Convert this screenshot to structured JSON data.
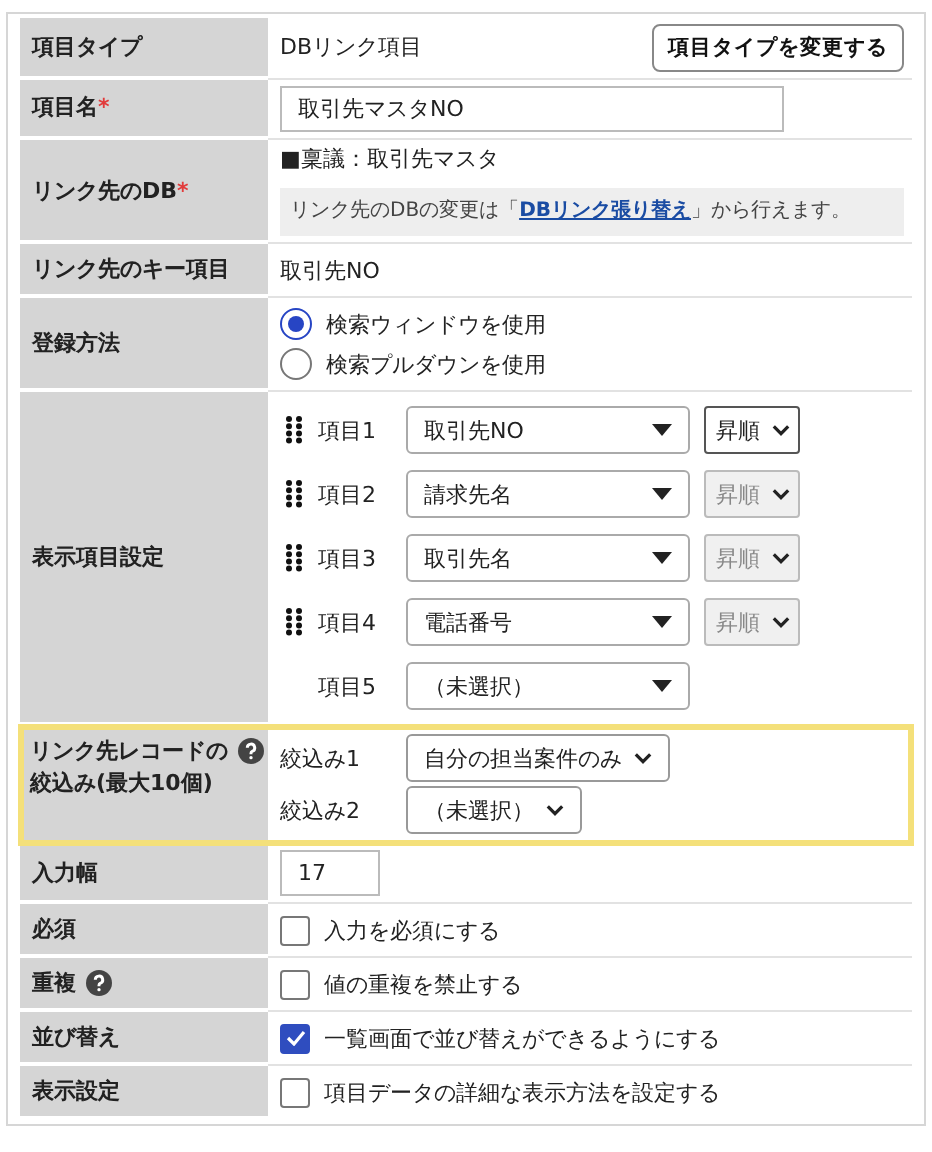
{
  "rows": [
    {
      "kind": "type",
      "label": "項目タイプ",
      "value": "DBリンク項目",
      "button": "項目タイプを変更する"
    },
    {
      "kind": "name",
      "label": "項目名",
      "required_mark": "*",
      "value": "取引先マスタNO"
    },
    {
      "kind": "db",
      "label": "リンク先のDB",
      "required_mark": "*",
      "value": "■稟議：取引先マスタ",
      "note_before": "リンク先のDBの変更は「",
      "link": "DBリンク張り替え",
      "note_after": "」から行えます。"
    },
    {
      "kind": "text",
      "label": "リンク先のキー項目",
      "value": "取引先NO"
    },
    {
      "kind": "radio",
      "label": "登録方法",
      "options": [
        {
          "label": "検索ウィンドウを使用",
          "selected": true
        },
        {
          "label": "検索プルダウンを使用",
          "selected": false
        }
      ]
    },
    {
      "kind": "display",
      "label": "表示項目設定",
      "items": [
        {
          "label": "項目1",
          "value": "取引先NO",
          "draggable": true,
          "order": "昇順",
          "order_disabled": false
        },
        {
          "label": "項目2",
          "value": "請求先名",
          "draggable": true,
          "order": "昇順",
          "order_disabled": true
        },
        {
          "label": "項目3",
          "value": "取引先名",
          "draggable": true,
          "order": "昇順",
          "order_disabled": true
        },
        {
          "label": "項目4",
          "value": "電話番号",
          "draggable": true,
          "order": "昇順",
          "order_disabled": true
        },
        {
          "label": "項目5",
          "value": "（未選択）",
          "draggable": false
        }
      ]
    },
    {
      "kind": "filter",
      "label": "リンク先レコードの",
      "label_sub": "絞込み(最大10個)",
      "help": true,
      "highlighted": true,
      "filters": [
        {
          "label": "絞込み1",
          "value": "自分の担当案件のみ"
        },
        {
          "label": "絞込み2",
          "value": "（未選択）"
        }
      ]
    },
    {
      "kind": "width",
      "label": "入力幅",
      "value": "17"
    },
    {
      "kind": "checkbox",
      "label": "必須",
      "text": "入力を必須にする",
      "checked": false
    },
    {
      "kind": "checkbox",
      "label": "重複",
      "help": true,
      "text": "値の重複を禁止する",
      "checked": false
    },
    {
      "kind": "checkbox",
      "label": "並び替え",
      "text": "一覧画面で並び替えができるようにする",
      "checked": true
    },
    {
      "kind": "checkbox",
      "label": "表示設定",
      "text": "項目データの詳細な表示方法を設定する",
      "checked": false
    }
  ]
}
